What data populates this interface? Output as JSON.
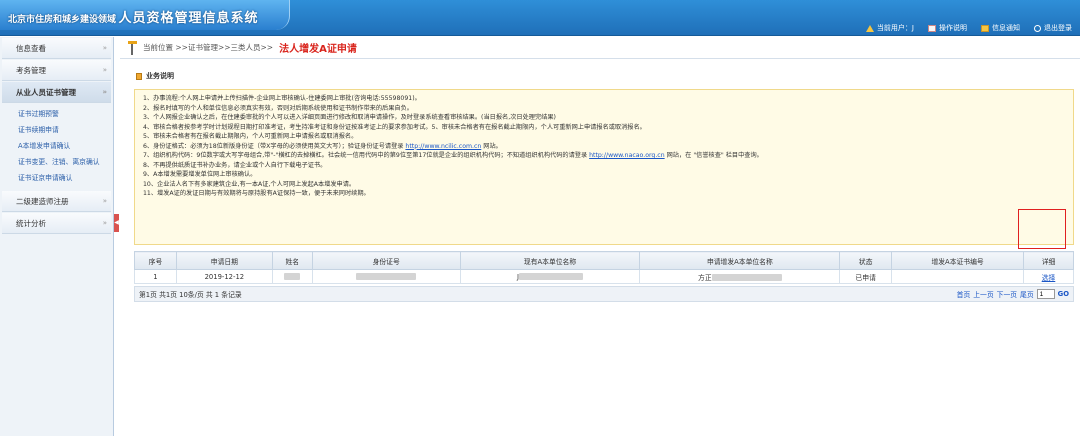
{
  "header": {
    "logo_sub": "北京市住房和城乡建设领域",
    "logo_main": "人员资格管理信息系统",
    "links": [
      {
        "label": "当前用户：J",
        "icon": "warning-icon"
      },
      {
        "label": "操作说明",
        "icon": "manual-icon"
      },
      {
        "label": "信息通知",
        "icon": "mail-icon"
      },
      {
        "label": "退出登录",
        "icon": "power-icon"
      }
    ]
  },
  "sidebar": {
    "items": [
      {
        "label": "信息查看"
      },
      {
        "label": "考务管理"
      },
      {
        "label": "从业人员证书管理",
        "open": true
      },
      {
        "label": "二级建造师注册"
      },
      {
        "label": "统计分析"
      }
    ],
    "sub_items": [
      "证书过期预警",
      "证书续期申请",
      "A本增发申请确认",
      "证书变更、注销、离京确认",
      "证书证京申请确认"
    ],
    "collapse": "◀"
  },
  "breadcrumb": {
    "path": "当前位置 >>证书管理>>三类人员>>",
    "title": "法人增发A证申请"
  },
  "notice": {
    "heading": "业务说明",
    "lines": [
      "1、办事流程:个人网上申请并上传扫描件-企业网上审核确认-住建委网上审批(咨询电话:55598091)。",
      "2、报名时填写的个人和单位信息必须真实有效，否则对后期系统使用和证书制作带来的后果自负。",
      "3、个人网报企业确认之后，在住建委审批的个人可以进入详细页面进行修改和取消申请操作，及时登录系统查看审核结果。(当日报名,次日处理完结果)",
      "4、审核合格者按参考学时计划规程日期打印准考证，考生持准考证和身份证按准考证上的要求参加考试。5、审核未合格者有在报名截止期限内，个人可重新网上申请报名或取消报名。",
      "5、审核未合格者有在报名截止期限内，个人可重新网上申请报名或取消报名。",
      "6、身份证格式：必须为18位新版身份证（带X字母的必须使用英文大写）；验证身份证号请登录",
      "7、组织机构代码：9位数字或大写字母组合,带\"-\"横杠的去掉横杠。社会统一信用代码中的第9位至第17位就是企业的组织机构代码；不知道组织机构代码的请登录",
      "8、不再提供纸质证书补办业务，请企业或个人自行下载电子证书。",
      "9、A本增发需要增发单位网上审核确认。",
      "10、企业法人名下有多家建筑企业,有一本A证,个人可网上发起A本增发申请。",
      "11、增发A证的发证日期与有效期将与原持股有A证保持一致，便于未来同时续期。"
    ],
    "link1": "http://www.ncilic.com.cn",
    "link1_suffix": " 网站。",
    "link2": "http://www.nacao.org.cn",
    "link2_suffix": " 网站，在 \"信誉核查\" 栏目中查询。"
  },
  "table": {
    "headers": [
      "序号",
      "申请日期",
      "姓名",
      "身份证号",
      "现有A本单位名称",
      "申请增发A本单位名称",
      "状态",
      "增发A本证书编号",
      "详细"
    ],
    "rows": [
      {
        "no": "1",
        "date": "2019-12-12",
        "name": "",
        "id": "",
        "current_unit": "J",
        "new_unit": "方正",
        "status": "已申请",
        "cert_no": "",
        "detail": "选择"
      }
    ]
  },
  "pager": {
    "summary": "第1页  共1页  10条/页  共 1 条记录",
    "links": [
      "首页",
      "上一页",
      "下一页",
      "尾页"
    ],
    "page_value": "1",
    "go": "GO"
  }
}
